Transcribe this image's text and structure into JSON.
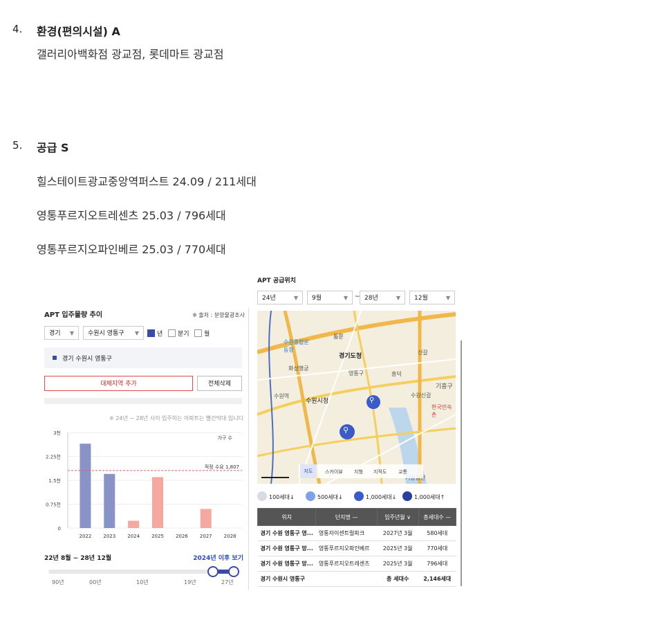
{
  "sections": {
    "env": {
      "num": "4.",
      "title": "환경(편의시설) A",
      "text": "갤러리아백화점 광교점, 롯데마트 광교점"
    },
    "supply": {
      "num": "5.",
      "title": "공급 S",
      "items": [
        "힐스테이트광교중앙역퍼스트 24.09 / 211세대",
        "영통푸르지오트레센츠 25.03 / 796세대",
        "영통푸르지오파인베르 25.03 / 770세대"
      ]
    }
  },
  "left_panel": {
    "title": "APT 입주물량 추이",
    "source": "※ 출처 : 분양물광조사",
    "region_select": "경기",
    "district_select": "수원시 영통구",
    "toggles": [
      {
        "label": "년",
        "checked": true
      },
      {
        "label": "분기",
        "checked": false
      },
      {
        "label": "월",
        "checked": false
      }
    ],
    "selected_region": "경기 수원시 영통구",
    "add_button": "대체지역 추가",
    "clear_button": "전체삭제",
    "note": "※ 24년 ~ 28년 사이 입주하는 아파트는 빨간막대 입니다",
    "range_label": "22년 8월 ~ 28년 12월",
    "after_link": "2024년 이후 보기",
    "slider_labels": [
      "90년",
      "00년",
      "10년",
      "19년",
      "27년"
    ]
  },
  "chart_data": {
    "type": "bar",
    "categories": [
      "2022",
      "2023",
      "2024",
      "2025",
      "2026",
      "2027",
      "2028"
    ],
    "values": [
      2650,
      1700,
      230,
      1600,
      0,
      600,
      0
    ],
    "colors": [
      "#8a93c8",
      "#8a93c8",
      "#f4a8a0",
      "#f4a8a0",
      "#f4a8a0",
      "#f4a8a0",
      "#f4a8a0"
    ],
    "ylabel": "가구 수",
    "ytick_labels": [
      "0",
      "0.75천",
      "1.5천",
      "2.25천",
      "3천"
    ],
    "ytick_values": [
      0,
      750,
      1500,
      2250,
      3000
    ],
    "ylim": [
      0,
      3000
    ],
    "reference_line": {
      "label": "적정 수요 1,807",
      "value": 1807,
      "color": "#e06060"
    }
  },
  "right_panel": {
    "title": "APT 공급위치",
    "from_year": "24년",
    "from_month": "9월",
    "to_year": "28년",
    "to_month": "12월",
    "tilde": "~",
    "map_labels": [
      "동문",
      "수원종합운동장",
      "경기도청",
      "화성행궁",
      "영통구",
      "수원시청",
      "기흥구",
      "한국민속촌",
      "신갈",
      "수원신갈",
      "수원역",
      "흥덕",
      "기흥동탄"
    ],
    "map_tabs": [
      "지도",
      "스카이뷰",
      "지형",
      "지적도",
      "교통"
    ],
    "legend": [
      "100세대↓",
      "500세대↓",
      "1,000세대↓",
      "1,000세대↑"
    ],
    "table": {
      "headers": [
        "위치",
        "단지명 —",
        "입주년월 ∨",
        "총세대수 —"
      ],
      "rows": [
        [
          "경기 수원 영통구 영...",
          "영통자이센트럴파크",
          "2027년 3월",
          "580세대"
        ],
        [
          "경기 수원 영통구 망...",
          "영통푸르지오파인베르",
          "2025년 3월",
          "770세대"
        ],
        [
          "경기 수원 영통구 망...",
          "영통푸르지오트레센츠",
          "2025년 3월",
          "796세대"
        ]
      ],
      "total": [
        "경기 수원시 영통구",
        "",
        "총 세대수",
        "2,146세대"
      ]
    }
  }
}
